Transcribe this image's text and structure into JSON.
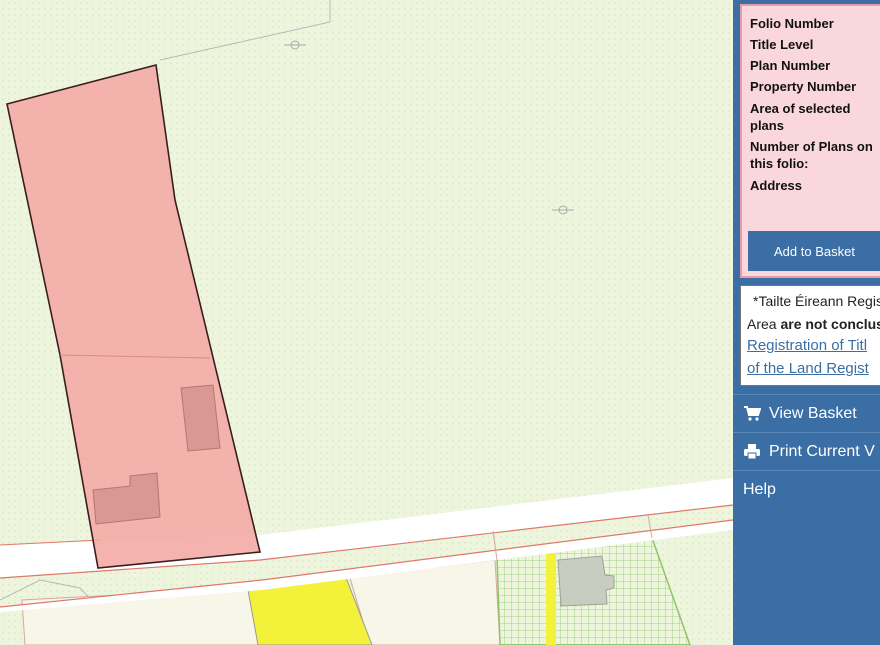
{
  "map": {
    "background_color": "#eef5dd",
    "selected_parcel_color": "#f3a6a2",
    "road_color": "#ffffff",
    "road_edge_color": "#e0786a",
    "yellow_parcel_color": "#f4f13a",
    "grid_parcel_color": "#a6d08a"
  },
  "info_panel": {
    "fields": [
      {
        "label_line1": "Folio Number",
        "label_line2": ""
      },
      {
        "label_line1": "Title Level",
        "label_line2": ""
      },
      {
        "label_line1": "Plan Number",
        "label_line2": ""
      },
      {
        "label_line1": "Property Number",
        "label_line2": ""
      },
      {
        "label_line1": "Area of selected",
        "label_line2": "plans"
      },
      {
        "label_line1": "Number of Plans on",
        "label_line2": "this folio:"
      },
      {
        "label_line1": "Address",
        "label_line2": ""
      }
    ],
    "add_button_label": "Add to Basket"
  },
  "disclaimer": {
    "line1": "*Tailte Éireann Regis",
    "line2_prefix": "Area ",
    "line2_bold": "are not conclus",
    "link1": "Registration of Titl",
    "link2": "of the Land Regist"
  },
  "menu": {
    "view_basket": {
      "label": "View Basket",
      "icon": "cart-icon"
    },
    "print": {
      "label": "Print Current V",
      "icon": "printer-icon"
    },
    "help": {
      "label": "Help"
    }
  },
  "colors": {
    "panel_blue": "#3a6ea5",
    "info_bg": "#f9d7dc",
    "info_border": "#e89aa6"
  }
}
